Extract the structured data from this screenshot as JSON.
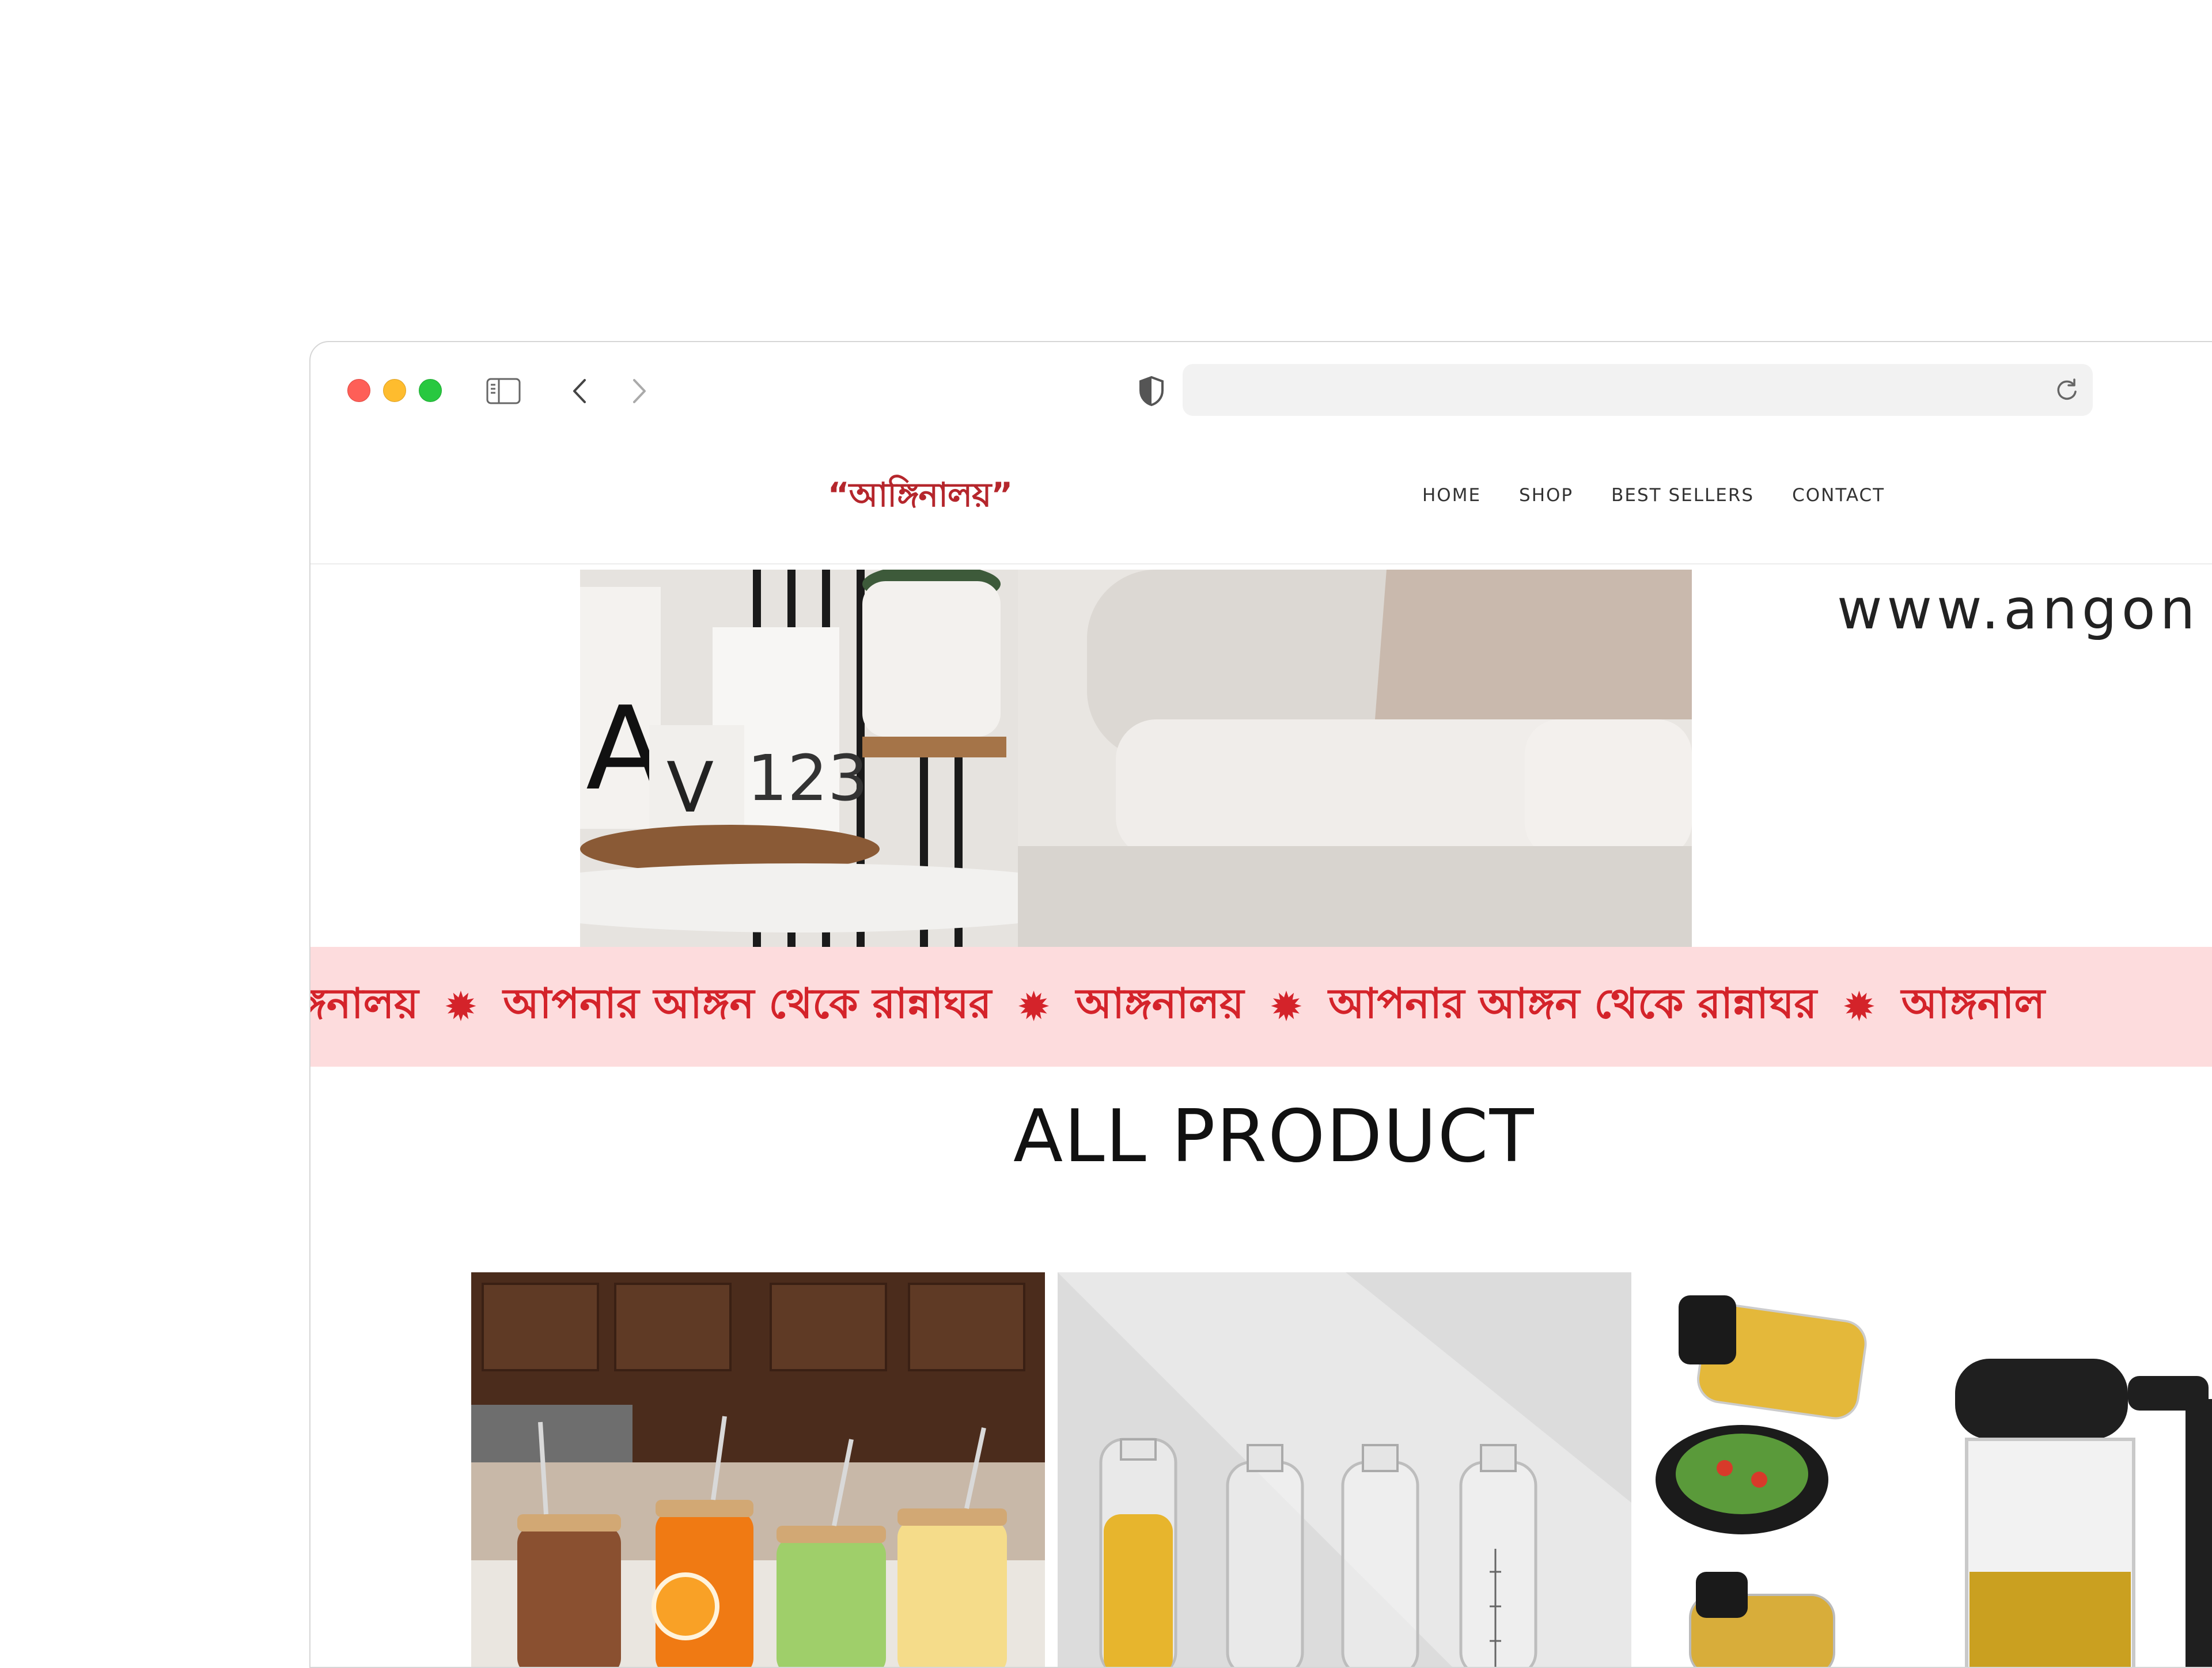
{
  "browser": {
    "address_text": ""
  },
  "site": {
    "logo": "“আঙ্গিনালয়”",
    "nav": [
      "HOME",
      "SHOP",
      "BEST SELLERS",
      "CONTACT"
    ]
  },
  "hero": {
    "side_text": "www.angon"
  },
  "marquee": {
    "items": [
      "ঙ্গনালয়",
      "আপনার আঙ্গন থেকে রান্নাঘর",
      "আঙ্গনালয়",
      "আপনার আঙ্গন থেকে রান্নাঘর",
      "আঙ্গনাল"
    ],
    "separator": "✹"
  },
  "products": {
    "title": "ALL PRODUCT"
  },
  "colors": {
    "brand": "#b5262c",
    "marquee_bg": "#fddcdd",
    "marquee_text": "#d4232a"
  }
}
